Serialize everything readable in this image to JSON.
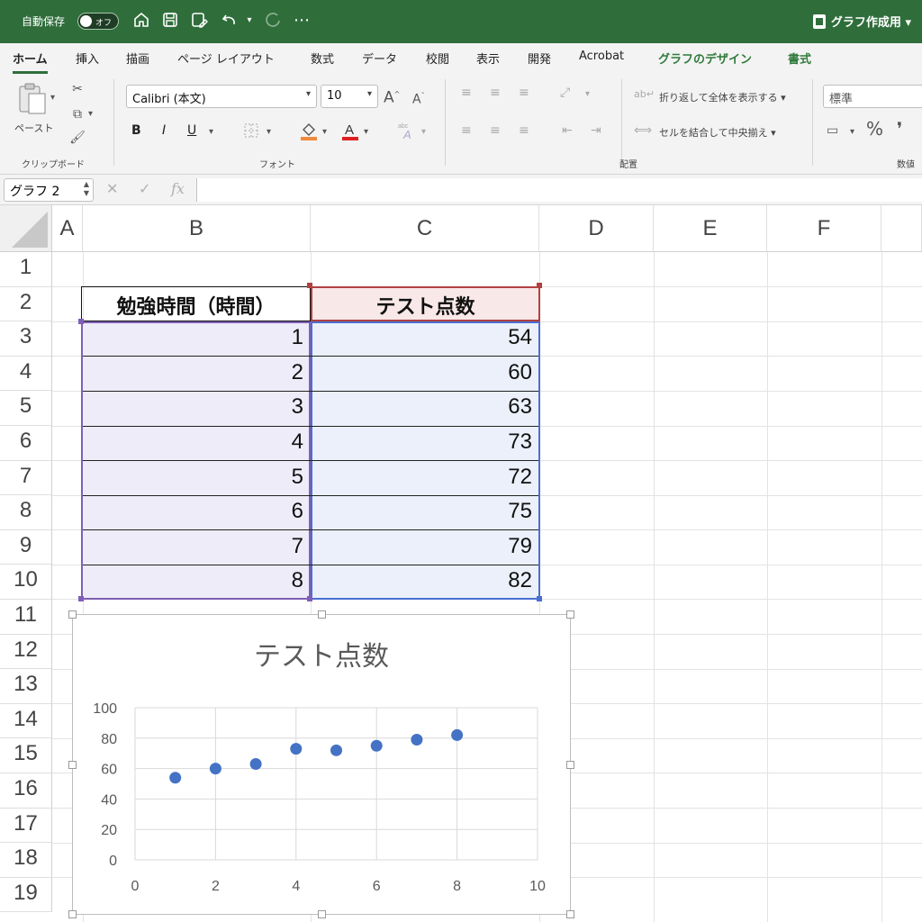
{
  "titlebar": {
    "autosave_label": "自動保存",
    "toggle_label": "オフ",
    "doc_title": "グラフ作成用"
  },
  "tabs": [
    {
      "label": "ホーム"
    },
    {
      "label": "挿入"
    },
    {
      "label": "描画"
    },
    {
      "label": "ページ レイアウト"
    },
    {
      "label": "数式"
    },
    {
      "label": "データ"
    },
    {
      "label": "校閲"
    },
    {
      "label": "表示"
    },
    {
      "label": "開発"
    },
    {
      "label": "Acrobat"
    },
    {
      "label": "グラフのデザイン"
    },
    {
      "label": "書式"
    }
  ],
  "ribbon": {
    "paste_label": "ペースト",
    "clipboard_label": "クリップボード",
    "font_label": "フォント",
    "font_name": "Calibri (本文)",
    "font_size": "10",
    "bold": "B",
    "italic": "I",
    "underline": "U",
    "grow_font": "A",
    "shrink_font": "A",
    "wrap_text": "折り返して全体を表示する",
    "merge_center": "セルを結合して中央揃え",
    "alignment_label": "配置",
    "number_format": "標準",
    "number_label": "数値",
    "percent": "%",
    "comma": "❜"
  },
  "formula_bar": {
    "name_box": "グラフ 2",
    "fx": "fx",
    "cancel": "✕",
    "enter": "✓",
    "content": ""
  },
  "grid": {
    "columns": [
      "A",
      "B",
      "C",
      "D",
      "E",
      "F"
    ],
    "rows": [
      "1",
      "2",
      "3",
      "4",
      "5",
      "6",
      "7",
      "8",
      "9",
      "10",
      "11",
      "12",
      "13",
      "14",
      "15",
      "16",
      "17",
      "18",
      "19"
    ],
    "table": {
      "header_b": "勉強時間（時間）",
      "header_c": "テスト点数",
      "hours": [
        "1",
        "2",
        "3",
        "4",
        "5",
        "6",
        "7",
        "8"
      ],
      "scores": [
        "54",
        "60",
        "63",
        "73",
        "72",
        "75",
        "79",
        "82"
      ]
    }
  },
  "colors": {
    "excel_green": "#2f6e3b",
    "range_purple": "#7f5fb5",
    "range_blue": "#4a6fd0",
    "range_red": "#b24040",
    "marker": "#4472c4"
  },
  "chart_data": {
    "type": "scatter",
    "title": "テスト点数",
    "x": [
      1,
      2,
      3,
      4,
      5,
      6,
      7,
      8
    ],
    "y": [
      54,
      60,
      63,
      73,
      72,
      75,
      79,
      82
    ],
    "xlim": [
      0,
      10
    ],
    "ylim": [
      0,
      100
    ],
    "x_ticks": [
      0,
      2,
      4,
      6,
      8,
      10
    ],
    "y_ticks": [
      0,
      20,
      40,
      60,
      80,
      100
    ],
    "grid": true,
    "marker_color": "#4472c4"
  }
}
